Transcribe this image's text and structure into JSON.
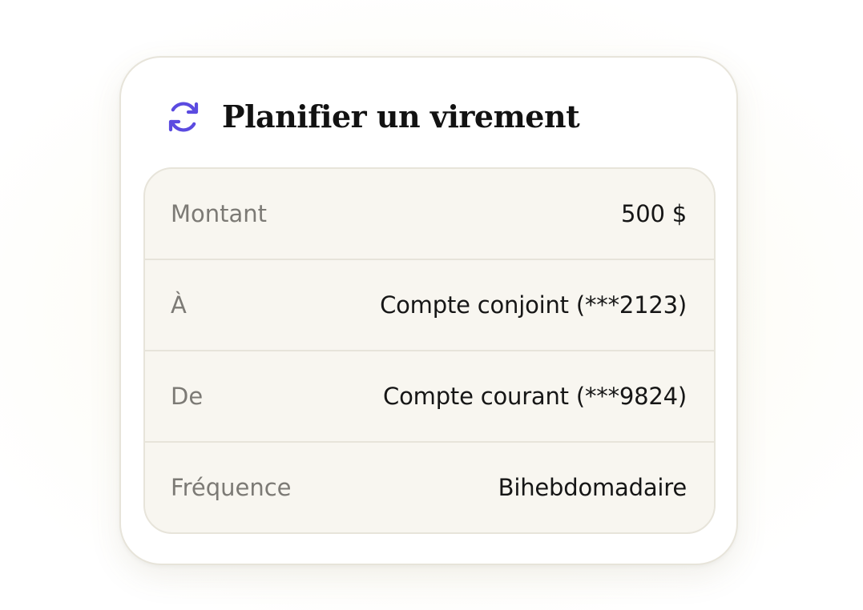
{
  "card": {
    "title": "Planifier un virement",
    "icon": "refresh-icon",
    "accent_color": "#5b4be0",
    "rows": [
      {
        "label": "Montant",
        "value": "500 $"
      },
      {
        "label": "À",
        "value": "Compte conjoint (***2123)"
      },
      {
        "label": "De",
        "value": "Compte courant (***9824)"
      },
      {
        "label": "Fréquence",
        "value": "Bihebdomadaire"
      }
    ]
  }
}
